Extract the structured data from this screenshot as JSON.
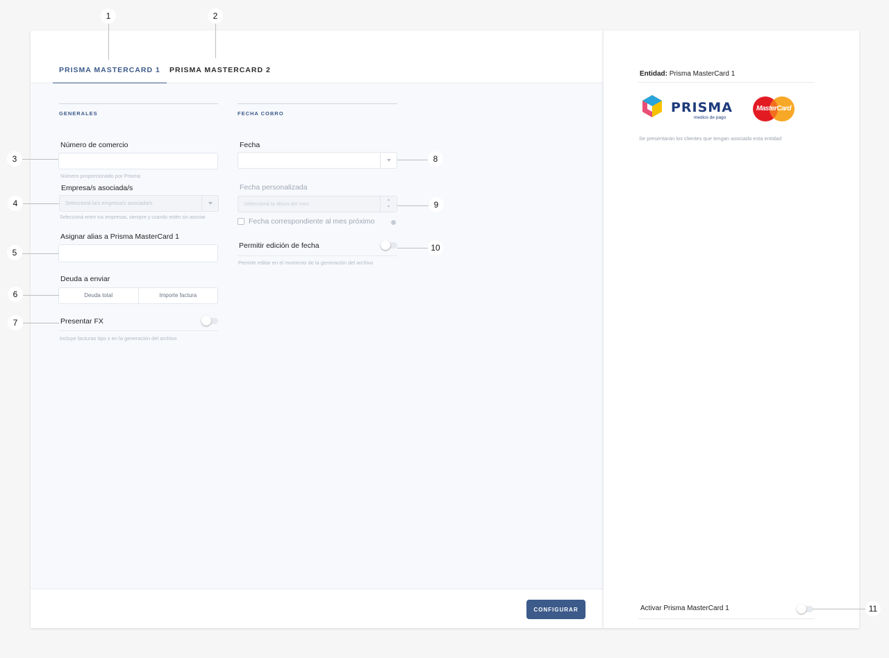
{
  "tabs": [
    {
      "label": "PRISMA MASTERCARD 1",
      "active": true
    },
    {
      "label": "PRISMA MASTERCARD 2",
      "active": false
    }
  ],
  "generales": {
    "title": "GENERALES",
    "numero_comercio": {
      "label": "Número de comercio",
      "value": "",
      "help": "Número proporcionado por Prisma"
    },
    "empresas": {
      "label": "Empresa/s asociada/s",
      "placeholder": "Seleccioná la/s empresa/s asociada/s",
      "help": "Seleccioná entre tus empresas, siempre y cuando estén sin asociar"
    },
    "alias": {
      "label": "Asignar alias a Prisma MasterCard 1",
      "value": ""
    },
    "deuda": {
      "label": "Deuda a enviar",
      "options": [
        "Deuda total",
        "Importe factura"
      ]
    },
    "presentar_fx": {
      "label": "Presentar FX",
      "help": "Incluye facturas tipo x en la generación del archivo",
      "enabled": false
    }
  },
  "fecha_cobro": {
    "title": "FECHA COBRO",
    "fecha": {
      "label": "Fecha",
      "value": ""
    },
    "fecha_personalizada": {
      "label": "Fecha personalizada",
      "placeholder": "Seleccioná la altura del mes"
    },
    "mes_proximo": {
      "label": "Fecha correspondiente al mes próximo",
      "checked": false
    },
    "permitir_edicion": {
      "label": "Permitir edición de fecha",
      "help": "Permite editar en el momento de la generación del archivo",
      "enabled": false
    }
  },
  "footer": {
    "configure_label": "CONFIGURAR"
  },
  "entity": {
    "label": "Entidad:",
    "value": "Prisma MasterCard 1",
    "logo_prisma_text": "PRISMA",
    "logo_prisma_sub": "medios de pago",
    "logo_mastercard_text": "MasterCard",
    "description": "Se presentarán los clientes que tengan asociada esta entidad",
    "activate_label": "Activar Prisma MasterCard 1",
    "activate_enabled": false
  },
  "callouts": [
    "1",
    "2",
    "3",
    "4",
    "5",
    "6",
    "7",
    "8",
    "9",
    "10",
    "11"
  ],
  "colors": {
    "accent": "#3c5a8a",
    "panel_bg": "#f7f9fc",
    "page_bg": "#f6f6f6"
  }
}
